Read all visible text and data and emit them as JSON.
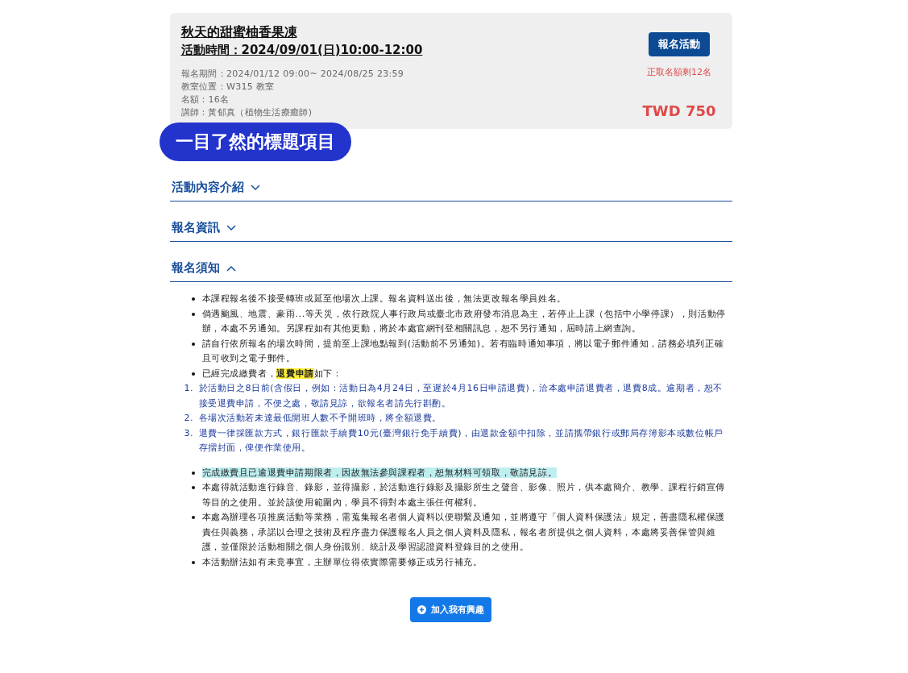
{
  "course": {
    "title": "秋天的甜蜜柚香果凍",
    "time": "活動時間：2024/09/01(日)10:00-12:00",
    "details": [
      "報名期間：2024/01/12 09:00~ 2024/08/25 23:59",
      "教室位置：W315 教室",
      "名額：16名",
      "講師：黃郁真（植物生活療癒師)"
    ],
    "register_button": "報名活動",
    "quota": "正取名額剩12名",
    "price": "TWD 750"
  },
  "badge": "一目了然的標題項目",
  "sections": [
    {
      "title": "活動內容介紹",
      "expanded": false
    },
    {
      "title": "報名資訊",
      "expanded": false
    },
    {
      "title": "報名須知",
      "expanded": true,
      "items": [
        {
          "kind": "bullet",
          "highlighted": false,
          "text": "本課程報名後不接受轉班或延至他場次上課。報名資料送出後，無法更改報名學員姓名。"
        },
        {
          "kind": "bullet",
          "highlighted": false,
          "text": "倘遇颱風、地震、豪雨...等天災，依行政院人事行政局或臺北市政府發布消息為主，若停止上課（包括中小學停課），則活動停辦，本處不另通知。另課程如有其他更動，將於本處官網刊登相關訊息，恕不另行通知，屆時請上網查詢。"
        },
        {
          "kind": "bullet",
          "highlighted": false,
          "text": "請自行依所報名的場次時間，提前至上課地點報到(活動前不另通知)。若有臨時通知事項，將以電子郵件通知，請務必填列正確且可收到之電子郵件。"
        },
        {
          "kind": "bullet",
          "highlighted": false,
          "text": "已經完成繳費者，**退費申請**如下："
        },
        {
          "kind": "numbered",
          "number": "1.",
          "highlighted": false,
          "text": "於活動日之8日前(含假日，例如：活動日為4月24日，至遲於4月16日申請退費)，洽本處申請退費者，退費8成。逾期者，恕不接受退費申請，不便之處，敬請見諒，欲報名者請先行斟酌。"
        },
        {
          "kind": "numbered",
          "number": "2.",
          "highlighted": false,
          "text": "各場次活動若未達最低開班人數不予開班時，將全額退費。"
        },
        {
          "kind": "numbered",
          "number": "3.",
          "highlighted": false,
          "text": "退費一律採匯款方式，銀行匯款手續費10元(臺灣銀行免手續費)，由退款金額中扣除，並請攜帶銀行或郵局存簿影本或數位帳戶存摺封面，俾便作業使用。"
        },
        {
          "kind": "bullet",
          "highlighted": true,
          "text": "完成繳費且已逾退費申請期限者，因故無法參與課程者，恕無材料可領取，敬請見諒。"
        },
        {
          "kind": "bullet",
          "highlighted": false,
          "text": "本處得就活動進行錄音、錄影，並得攝影，於活動進行錄影及攝影所生之聲音、影像、照片，供本處簡介、教學、課程行銷宣傳等目的之使用。並於該使用範圍內，學員不得對本處主張任何權利。"
        },
        {
          "kind": "bullet",
          "highlighted": false,
          "text": "本處為辦理各項推廣活動等業務，需蒐集報名者個人資料以便聯繫及通知，並將遵守「個人資料保護法」規定，善盡隱私權保護責任與義務，承諾以合理之技術及程序盡力保護報名人員之個人資料及隱私，報名者所提供之個人資料，本處將妥善保管與維護，並僅限於活動相關之個人身份識別、統計及學習認證資料登錄目的之使用。"
        },
        {
          "kind": "bullet",
          "highlighted": false,
          "text": "本活動辦法如有未竟事宜，主辦單位得依實際需要修正或另行補充。"
        }
      ]
    }
  ],
  "interest_button": "加入我有興趣"
}
